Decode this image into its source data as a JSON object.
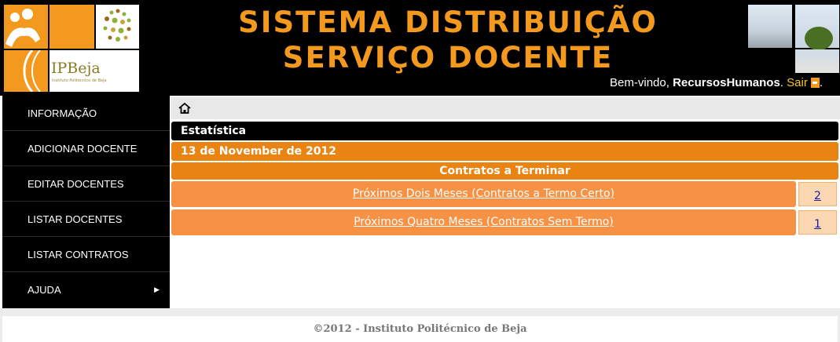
{
  "header": {
    "title_line1": "SISTEMA DISTRIBUIÇÃO",
    "title_line2": "SERVIÇO DOCENTE",
    "logo_text": "IPBeja",
    "logo_subtext": "Instituto Politécnico de Beja",
    "welcome_prefix": "Bem-vindo, ",
    "user_name": "RecursosHumanos",
    "separator": ". ",
    "logout_label": "Sair",
    "trailing": "."
  },
  "sidebar": {
    "items": [
      {
        "label": "INFORMAÇÃO"
      },
      {
        "label": "ADICIONAR DOCENTE"
      },
      {
        "label": "EDITAR DOCENTES"
      },
      {
        "label": "LISTAR DOCENTES"
      },
      {
        "label": "LISTAR CONTRATOS"
      },
      {
        "label": "AJUDA",
        "arrow": "▶"
      }
    ]
  },
  "main": {
    "section_title": "Estatística",
    "date": "13 de November de 2012",
    "table_header": "Contratos a Terminar",
    "rows": [
      {
        "label": "Próximos Dois Meses (Contratos a Termo Certo)",
        "count": "2"
      },
      {
        "label": "Próximos Quatro Meses (Contratos Sem Termo)",
        "count": "1"
      }
    ]
  },
  "footer": {
    "text": "©2012 - Instituto Politécnico de Beja"
  },
  "colors": {
    "accent": "#f39a1e",
    "row_orange": "#e98412",
    "link_row": "#f79144",
    "count_bg": "#fbd8b1"
  },
  "icons": {
    "home": "home-icon",
    "logout": "logout-icon",
    "submenu": "chevron-right-icon"
  }
}
